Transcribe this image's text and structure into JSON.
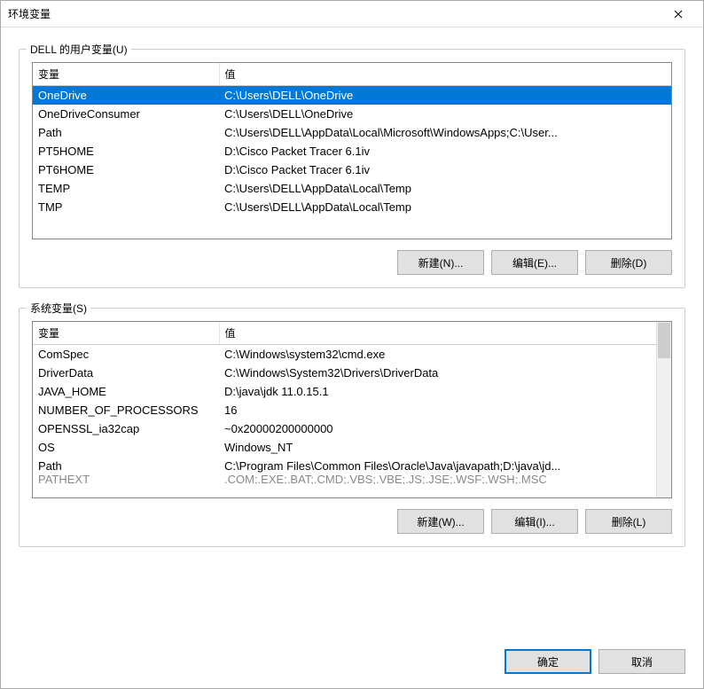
{
  "window": {
    "title": "环境变量"
  },
  "user_section": {
    "label": "DELL 的用户变量(U)",
    "headers": {
      "variable": "变量",
      "value": "值"
    },
    "rows": [
      {
        "variable": "OneDrive",
        "value": "C:\\Users\\DELL\\OneDrive",
        "selected": true
      },
      {
        "variable": "OneDriveConsumer",
        "value": "C:\\Users\\DELL\\OneDrive"
      },
      {
        "variable": "Path",
        "value": "C:\\Users\\DELL\\AppData\\Local\\Microsoft\\WindowsApps;C:\\User..."
      },
      {
        "variable": "PT5HOME",
        "value": "D:\\Cisco Packet Tracer 6.1iv"
      },
      {
        "variable": "PT6HOME",
        "value": "D:\\Cisco Packet Tracer 6.1iv"
      },
      {
        "variable": "TEMP",
        "value": "C:\\Users\\DELL\\AppData\\Local\\Temp"
      },
      {
        "variable": "TMP",
        "value": "C:\\Users\\DELL\\AppData\\Local\\Temp"
      }
    ],
    "buttons": {
      "new": "新建(N)...",
      "edit": "编辑(E)...",
      "delete": "删除(D)"
    }
  },
  "system_section": {
    "label": "系统变量(S)",
    "headers": {
      "variable": "变量",
      "value": "值"
    },
    "rows": [
      {
        "variable": "ComSpec",
        "value": "C:\\Windows\\system32\\cmd.exe"
      },
      {
        "variable": "DriverData",
        "value": "C:\\Windows\\System32\\Drivers\\DriverData"
      },
      {
        "variable": "JAVA_HOME",
        "value": "D:\\java\\jdk 11.0.15.1"
      },
      {
        "variable": "NUMBER_OF_PROCESSORS",
        "value": "16"
      },
      {
        "variable": "OPENSSL_ia32cap",
        "value": "~0x20000200000000"
      },
      {
        "variable": "OS",
        "value": "Windows_NT"
      },
      {
        "variable": "Path",
        "value": "C:\\Program Files\\Common Files\\Oracle\\Java\\javapath;D:\\java\\jd..."
      }
    ],
    "cutoff_row": {
      "variable": "PATHEXT",
      "value": ".COM;.EXE;.BAT;.CMD;.VBS;.VBE;.JS;.JSE;.WSF;.WSH;.MSC"
    },
    "buttons": {
      "new": "新建(W)...",
      "edit": "编辑(I)...",
      "delete": "删除(L)"
    }
  },
  "dialog_buttons": {
    "ok": "确定",
    "cancel": "取消"
  }
}
